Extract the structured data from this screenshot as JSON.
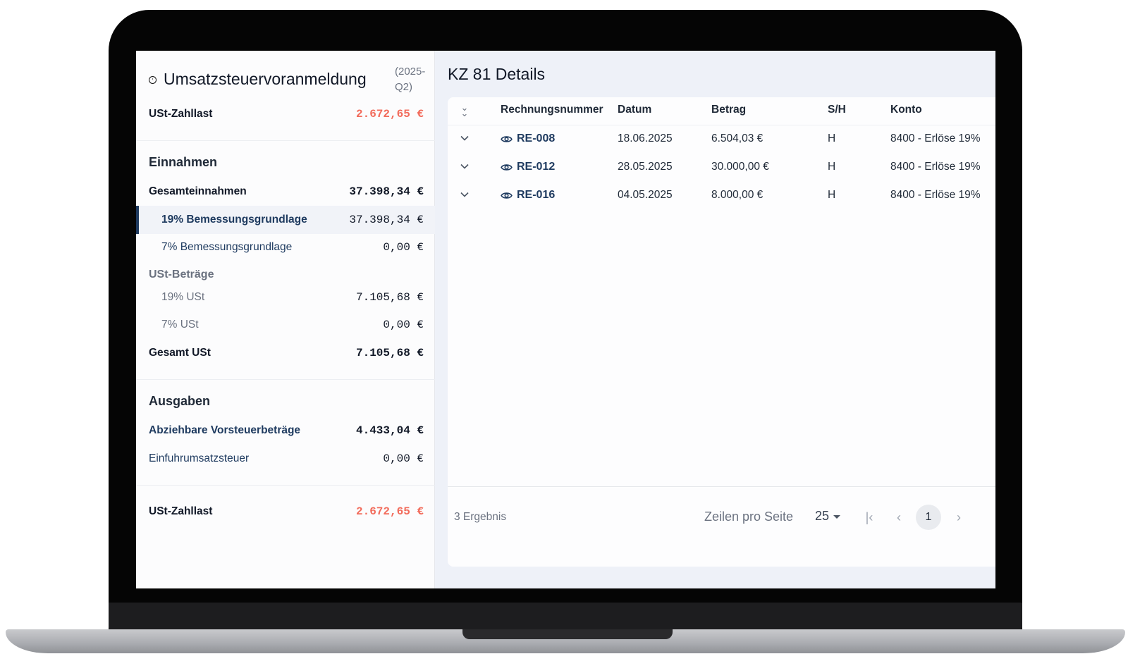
{
  "left_panel": {
    "title": "Umsatzsteuervoranmeldung",
    "period": "(2025-Q2)",
    "zahllast_top": {
      "label": "USt-Zahllast",
      "value": "2.672,65 €"
    },
    "einnahmen": {
      "title": "Einnahmen",
      "gesamt": {
        "label": "Gesamteinnahmen",
        "value": "37.398,34 €"
      },
      "bmg19": {
        "label": "19% Bemessungsgrundlage",
        "value": "37.398,34 €"
      },
      "bmg7": {
        "label": "7% Bemessungsgrundlage",
        "value": "0,00 €"
      },
      "ust_title": "USt-Beträge",
      "ust19": {
        "label": "19% USt",
        "value": "7.105,68 €"
      },
      "ust7": {
        "label": "7% USt",
        "value": "0,00 €"
      },
      "ust_gesamt": {
        "label": "Gesamt USt",
        "value": "7.105,68 €"
      }
    },
    "ausgaben": {
      "title": "Ausgaben",
      "vorsteuer": {
        "label": "Abziehbare Vorsteuerbeträge",
        "value": "4.433,04 €"
      },
      "einfuhr": {
        "label": "Einfuhrumsatzsteuer",
        "value": "0,00 €"
      }
    },
    "zahllast_bottom": {
      "label": "USt-Zahllast",
      "value": "2.672,65 €"
    }
  },
  "right_panel": {
    "title": "KZ 81 Details",
    "columns": [
      "Rechnungsnummer",
      "Datum",
      "Betrag",
      "S/H",
      "Konto"
    ],
    "rows": [
      {
        "invoice": "RE-008",
        "date": "18.06.2025",
        "amount": "6.504,03 €",
        "sh": "H",
        "account": "8400 - Erlöse 19%"
      },
      {
        "invoice": "RE-012",
        "date": "28.05.2025",
        "amount": "30.000,00 €",
        "sh": "H",
        "account": "8400 - Erlöse 19%"
      },
      {
        "invoice": "RE-016",
        "date": "04.05.2025",
        "amount": "8.000,00 €",
        "sh": "H",
        "account": "8400 - Erlöse 19%"
      }
    ],
    "footer": {
      "results": "3 Ergebnis",
      "rows_per_page_label": "Zeilen pro Seite",
      "rows_per_page_value": "25",
      "current_page": "1"
    }
  },
  "colors": {
    "accent": "#1e3a5f",
    "negative": "#f26b5b",
    "panel_bg": "#eef1f8"
  },
  "icons": [
    "back-icon",
    "collapse-all-icon",
    "chevron-down-icon",
    "eye-icon",
    "first-page-icon",
    "prev-page-icon",
    "next-page-icon",
    "caret-down-icon"
  ]
}
